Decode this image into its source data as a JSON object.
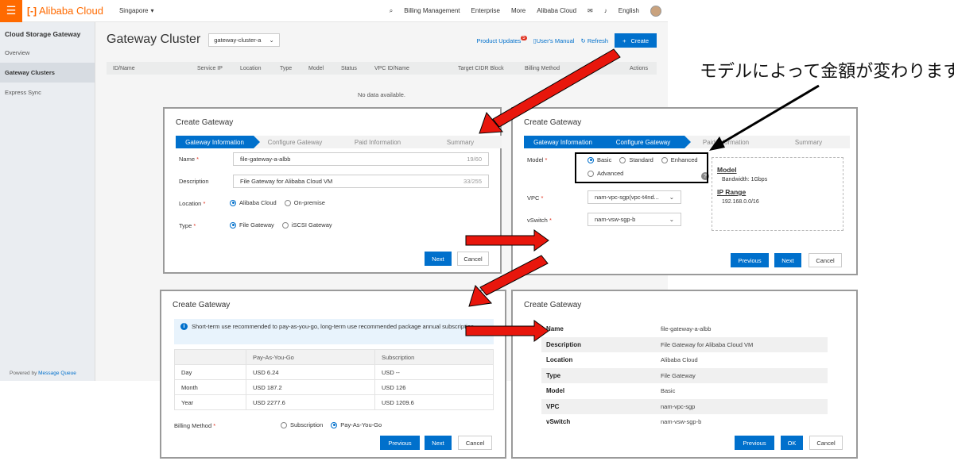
{
  "console": {
    "brand": "Alibaba Cloud",
    "region": "Singapore",
    "nav": [
      "Billing Management",
      "Enterprise",
      "More",
      "Alibaba Cloud",
      "English"
    ],
    "sidebar": {
      "title": "Cloud Storage Gateway",
      "items": [
        "Overview",
        "Gateway Clusters",
        "Express Sync"
      ],
      "footer_prefix": "Powered by",
      "footer_link": "Message Queue"
    },
    "page_title": "Gateway Cluster",
    "cluster_select": "gateway-cluster-a",
    "product_updates": "Product Updates",
    "product_updates_count": "5",
    "users_manual": "User's Manual",
    "refresh": "Refresh",
    "create": "Create",
    "columns": [
      "ID/Name",
      "Service IP",
      "Location",
      "Type",
      "Model",
      "Status",
      "VPC ID/Name",
      "Target CIDR Block",
      "Billing Method",
      "Actions"
    ],
    "empty_text": "No data available."
  },
  "annotation": "モデルによって金額が変わります",
  "dialog1": {
    "title": "Create Gateway",
    "steps": [
      "Gateway Information",
      "Configure Gateway",
      "Paid Information",
      "Summary"
    ],
    "name_label": "Name",
    "name_value": "file-gateway-a-albb",
    "name_count": "19/60",
    "desc_label": "Description",
    "desc_value": "File Gateway for Alibaba Cloud VM",
    "desc_count": "33/255",
    "location_label": "Location",
    "location_options": [
      "Alibaba Cloud",
      "On-premise"
    ],
    "type_label": "Type",
    "type_options": [
      "File Gateway",
      "iSCSI Gateway"
    ],
    "next": "Next",
    "cancel": "Cancel"
  },
  "dialog2": {
    "title": "Create Gateway",
    "steps": [
      "Gateway Information",
      "Configure Gateway",
      "Paid Information",
      "Summary"
    ],
    "model_label": "Model",
    "model_options": [
      "Basic",
      "Standard",
      "Enhanced",
      "Advanced"
    ],
    "vpc_label": "VPC",
    "vpc_value": "nam-vpc-sgp(vpc-t4nd...",
    "vswitch_label": "vSwitch",
    "vswitch_value": "nam-vsw-sgp-b",
    "info_model_h": "Model",
    "info_model_v": "Bandwidth: 1Gbps",
    "info_ip_h": "IP Range",
    "info_ip_v": "192.168.0.0/16",
    "previous": "Previous",
    "next": "Next",
    "cancel": "Cancel"
  },
  "dialog3": {
    "title": "Create Gateway",
    "notice": "Short-term use recommended to pay-as-you-go, long-term use recommended package annual subscription.",
    "table_headers": [
      "",
      "Pay-As-You-Go",
      "Subscription"
    ],
    "table_rows": [
      [
        "Day",
        "USD 6.24",
        "USD --"
      ],
      [
        "Month",
        "USD 187.2",
        "USD 126"
      ],
      [
        "Year",
        "USD 2277.6",
        "USD 1209.6"
      ]
    ],
    "billing_label": "Billing Method",
    "billing_options": [
      "Subscription",
      "Pay-As-You-Go"
    ],
    "previous": "Previous",
    "next": "Next",
    "cancel": "Cancel"
  },
  "dialog4": {
    "title": "Create Gateway",
    "rows": [
      [
        "Name",
        "file-gateway-a-albb"
      ],
      [
        "Description",
        "File Gateway for Alibaba Cloud VM"
      ],
      [
        "Location",
        "Alibaba Cloud"
      ],
      [
        "Type",
        "File Gateway"
      ],
      [
        "Model",
        "Basic"
      ],
      [
        "VPC",
        "nam-vpc-sgp"
      ],
      [
        "vSwitch",
        "nam-vsw-sgp-b"
      ]
    ],
    "previous": "Previous",
    "ok": "OK",
    "cancel": "Cancel"
  },
  "colors": {
    "accent": "#0070cc",
    "brand": "#ff6a00",
    "arrow": "#e8160c"
  }
}
